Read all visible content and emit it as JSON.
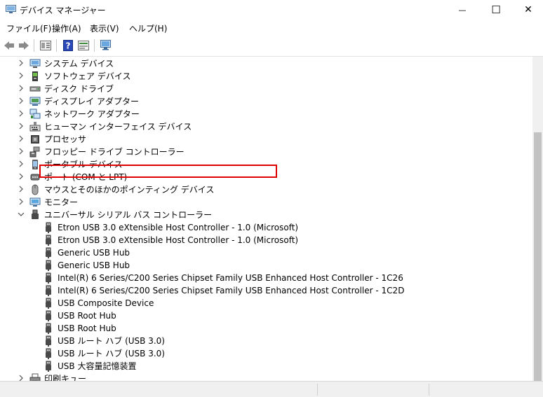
{
  "window": {
    "title": "デバイス マネージャー",
    "minimize_glyph": "—",
    "maximize_glyph": "☐",
    "close_glyph": "✕"
  },
  "menu": [
    {
      "label": "ファイル(F)"
    },
    {
      "label": "操作(A)"
    },
    {
      "label": "表示(V)"
    },
    {
      "label": "ヘルプ(H)"
    }
  ],
  "toolbar": {
    "icons": [
      "back-arrow-icon",
      "forward-arrow-icon",
      "properties-icon",
      "help-icon",
      "update-driver-icon",
      "scan-hardware-icon"
    ]
  },
  "tree": {
    "categories": [
      {
        "label": "システム デバイス",
        "icon": "system-devices-icon",
        "expanded": false
      },
      {
        "label": "ソフトウェア デバイス",
        "icon": "software-devices-icon",
        "expanded": false
      },
      {
        "label": "ディスク ドライブ",
        "icon": "disk-drive-icon",
        "expanded": false
      },
      {
        "label": "ディスプレイ アダプター",
        "icon": "display-adapter-icon",
        "expanded": false
      },
      {
        "label": "ネットワーク アダプター",
        "icon": "network-adapter-icon",
        "expanded": false
      },
      {
        "label": "ヒューマン インターフェイス デバイス",
        "icon": "hid-icon",
        "expanded": false
      },
      {
        "label": "プロセッサ",
        "icon": "processor-icon",
        "expanded": false
      },
      {
        "label": "フロッピー ドライブ コントローラー",
        "icon": "floppy-controller-icon",
        "expanded": false
      },
      {
        "label": "ポータブル デバイス",
        "icon": "portable-device-icon",
        "expanded": false
      },
      {
        "label": "ポート (COM と LPT)",
        "icon": "port-icon",
        "expanded": false
      },
      {
        "label": "マウスとそのほかのポインティング デバイス",
        "icon": "mouse-icon",
        "expanded": false
      },
      {
        "label": "モニター",
        "icon": "monitor-icon",
        "expanded": false
      },
      {
        "label": "ユニバーサル シリアル バス コントローラー",
        "icon": "usb-controller-icon",
        "expanded": true
      }
    ],
    "usb_children": [
      {
        "label": "Etron USB 3.0 eXtensible Host Controller - 1.0 (Microsoft)",
        "highlighted": true
      },
      {
        "label": "Etron USB 3.0 eXtensible Host Controller - 1.0 (Microsoft)",
        "highlighted": false
      },
      {
        "label": "Generic USB Hub",
        "highlighted": false
      },
      {
        "label": "Generic USB Hub",
        "highlighted": false
      },
      {
        "label": "Intel(R) 6 Series/C200 Series Chipset Family USB Enhanced Host Controller - 1C26",
        "highlighted": false
      },
      {
        "label": "Intel(R) 6 Series/C200 Series Chipset Family USB Enhanced Host Controller - 1C2D",
        "highlighted": false
      },
      {
        "label": "USB Composite Device",
        "highlighted": false
      },
      {
        "label": "USB Root Hub",
        "highlighted": false
      },
      {
        "label": "USB Root Hub",
        "highlighted": false
      },
      {
        "label": "USB ルート ハブ (USB 3.0)",
        "highlighted": false
      },
      {
        "label": "USB ルート ハブ (USB 3.0)",
        "highlighted": false
      },
      {
        "label": "USB 大容量記憶装置",
        "highlighted": false
      }
    ],
    "after": [
      {
        "label": "印刷キュー",
        "icon": "printer-icon",
        "expanded": false
      }
    ]
  },
  "colors": {
    "highlight_box": "#e00000",
    "chevron": "#505050"
  }
}
